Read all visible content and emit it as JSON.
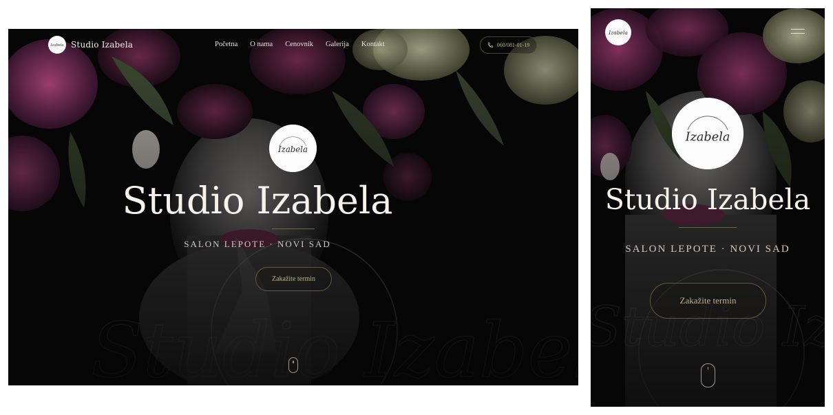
{
  "brand": {
    "name": "Studio Izabela",
    "logo_script": "Studio Izabela",
    "logo_arc": "BEAUTY SALON"
  },
  "nav": {
    "items": [
      {
        "label": "Početna"
      },
      {
        "label": "O nama"
      },
      {
        "label": "Cenovnik"
      },
      {
        "label": "Galerija"
      },
      {
        "label": "Kontakt"
      }
    ],
    "phone": "060/081-01-19"
  },
  "hero": {
    "title": "Studio Izabela",
    "subtitle": "SALON LEPOTE · NOVI SAD",
    "cta": "Zakažite termin",
    "watermark_script": "Studio Izabela",
    "watermark_arc": "BEAUTY SALON"
  },
  "colors": {
    "background": "#070607",
    "title": "#f6f2ec",
    "accent_olive": "#c3b98a",
    "flower_magenta": "#7a2a5a"
  },
  "icons": [
    "phone-icon",
    "mouse-scroll-icon",
    "hamburger-menu-icon"
  ]
}
